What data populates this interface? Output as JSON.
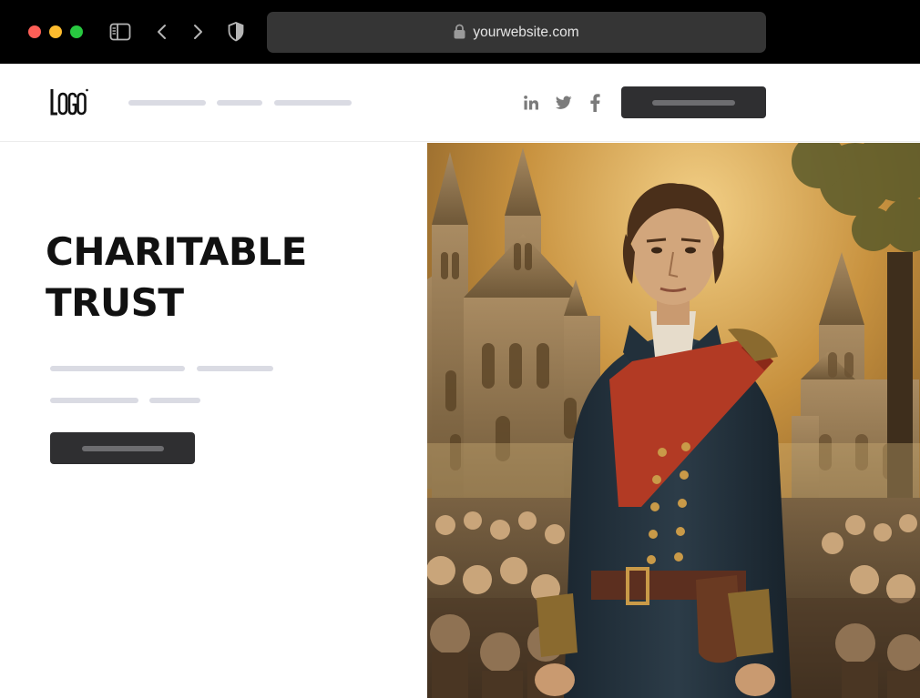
{
  "browser": {
    "url": "yourwebsite.com",
    "icons": [
      "sidebar-icon",
      "back-icon",
      "forward-icon",
      "shield-icon",
      "lock-icon"
    ]
  },
  "header": {
    "logo_text": "LOGO",
    "social": [
      "linkedin-icon",
      "twitter-icon",
      "facebook-icon"
    ]
  },
  "hero": {
    "title_line1": "CHARITABLE",
    "title_line2": "TRUST"
  },
  "colors": {
    "chrome": "#000000",
    "address_bar": "#353535",
    "button": "#2f2f31",
    "placeholder": "#dadbe3",
    "title": "#111111"
  }
}
